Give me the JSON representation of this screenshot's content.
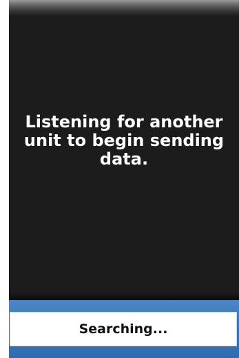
{
  "screen": {
    "message": "Listening for another unit to begin sending data."
  },
  "status_bar": {
    "status_text": "Searching..."
  },
  "colors": {
    "screen_background": "#1c1c1c",
    "message_text": "#ffffff",
    "accent_bar": "#3a78bb",
    "status_box": "#ffffff"
  }
}
